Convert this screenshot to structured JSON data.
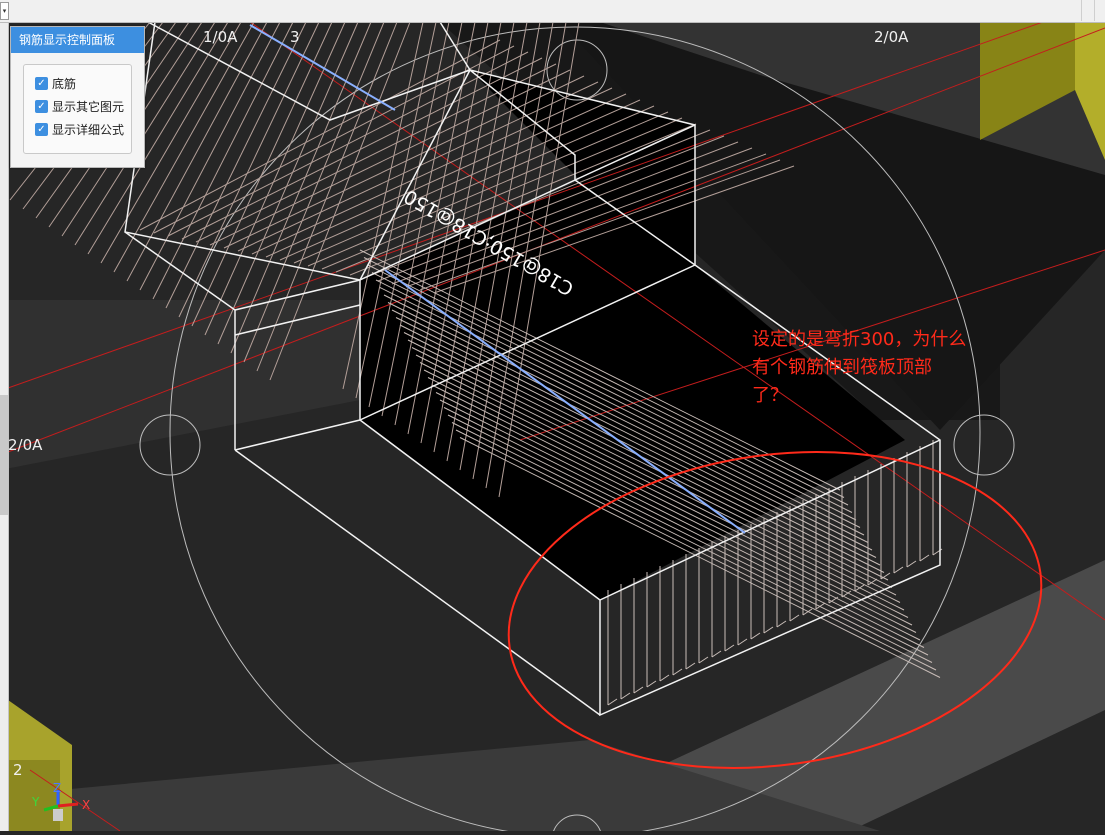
{
  "panel": {
    "title": "钢筋显示控制面板",
    "options": [
      {
        "label": "底筋",
        "checked": true
      },
      {
        "label": "显示其它图元",
        "checked": true
      },
      {
        "label": "显示详细公式",
        "checked": true
      }
    ]
  },
  "axes_labels": {
    "top_left": "1/0A",
    "top_num": "3",
    "top_right": "2/0A",
    "left": "2/0A",
    "bottom_left": "2"
  },
  "rebar_label": "C18@150;C18@150",
  "annotation": {
    "line1": "设定的是弯折300，为什么",
    "line2": "有个钢筋伸到筏板顶部",
    "line3": "了？",
    "color": "#ff2a1a"
  },
  "gizmo": {
    "z": "Z",
    "y": "Y",
    "x": "X"
  },
  "colors": {
    "background": "#262626",
    "grid_red": "#c41d1d",
    "panel_header": "#3d8fe0",
    "highlight_bar": "#8ab0ff"
  }
}
